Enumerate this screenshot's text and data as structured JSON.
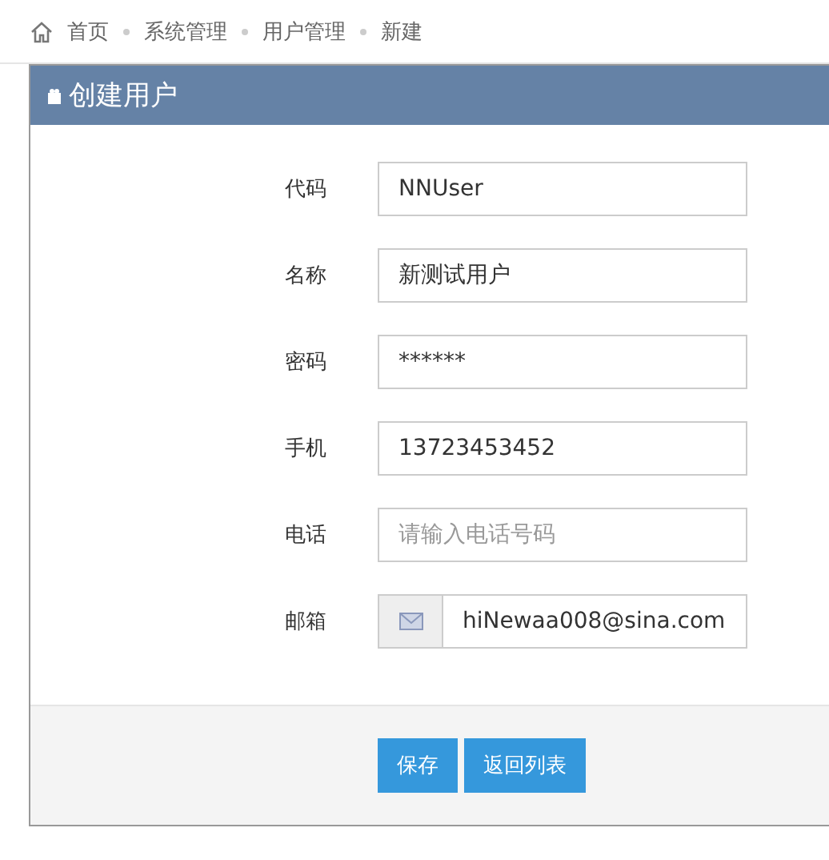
{
  "breadcrumb": [
    "首页",
    "系统管理",
    "用户管理",
    "新建"
  ],
  "panel": {
    "title": "创建用户"
  },
  "fields": [
    {
      "kind": "text",
      "label": "代码",
      "value": "NNUser"
    },
    {
      "kind": "text",
      "label": "名称",
      "value": "新测试用户"
    },
    {
      "kind": "password",
      "label": "密码",
      "value": "******"
    },
    {
      "kind": "text",
      "label": "手机",
      "value": "13723453452"
    },
    {
      "kind": "text",
      "label": "电话",
      "placeholder": "请输入电话号码"
    },
    {
      "kind": "email",
      "label": "邮箱",
      "value": "hiNewaa008@sina.com"
    }
  ],
  "buttons": [
    "保存",
    "返回列表"
  ]
}
